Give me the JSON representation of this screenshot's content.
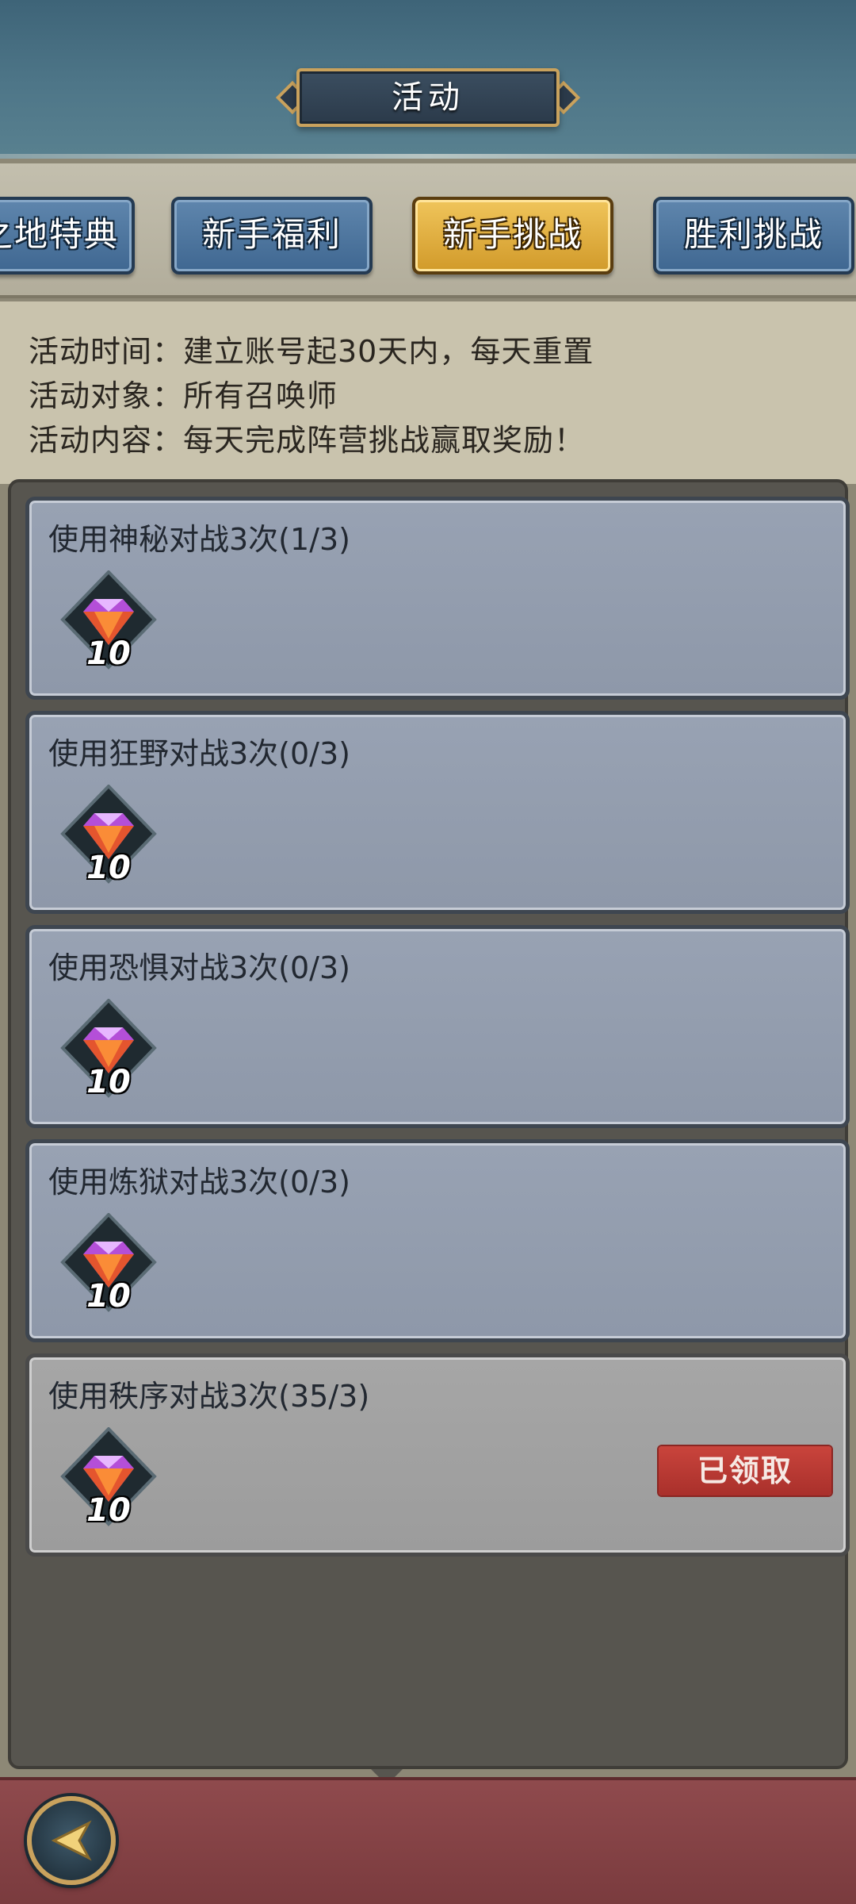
{
  "header": {
    "title": "活动"
  },
  "tabs": [
    {
      "label": "之地特典",
      "active": false
    },
    {
      "label": "新手福利",
      "active": false
    },
    {
      "label": "新手挑战",
      "active": true
    },
    {
      "label": "胜利挑战",
      "active": false
    }
  ],
  "info": {
    "time": "活动时间：建立账号起30天内，每天重置",
    "target": "活动对象：所有召唤师",
    "content": "活动内容：每天完成阵营挑战赢取奖励！"
  },
  "tasks": [
    {
      "title": "使用神秘对战3次(1/3)",
      "reward_icon": "purple-gem-icon",
      "reward_count": "10",
      "claimed": false
    },
    {
      "title": "使用狂野对战3次(0/3)",
      "reward_icon": "purple-gem-icon",
      "reward_count": "10",
      "claimed": false
    },
    {
      "title": "使用恐惧对战3次(0/3)",
      "reward_icon": "purple-gem-icon",
      "reward_count": "10",
      "claimed": false
    },
    {
      "title": "使用炼狱对战3次(0/3)",
      "reward_icon": "purple-gem-icon",
      "reward_count": "10",
      "claimed": false
    },
    {
      "title": "使用秩序对战3次(35/3)",
      "reward_icon": "purple-gem-icon",
      "reward_count": "10",
      "claimed": true,
      "status_label": "已领取"
    }
  ],
  "footer": {
    "back_icon": "back-arrow-icon"
  },
  "colors": {
    "tab_active": "#e2b041",
    "tab_inactive": "#4f77a0",
    "claimed_badge": "#b8372f",
    "gem": "#b44fd8"
  }
}
